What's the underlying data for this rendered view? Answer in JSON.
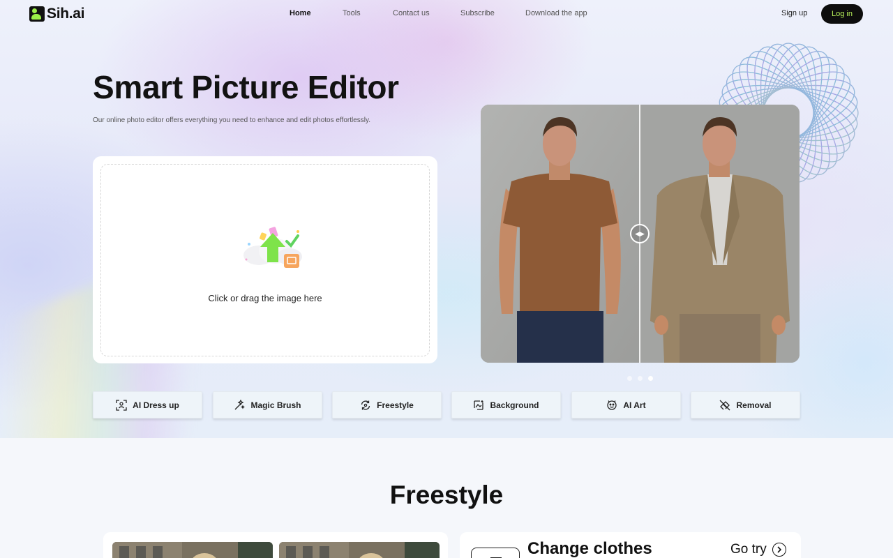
{
  "brand": {
    "name": "Sih.ai",
    "accent": "#9bf048"
  },
  "nav": {
    "items": [
      {
        "label": "Home",
        "active": true
      },
      {
        "label": "Tools",
        "active": false
      },
      {
        "label": "Contact us",
        "active": false
      },
      {
        "label": "Subscribe",
        "active": false
      },
      {
        "label": "Download the app",
        "active": false
      }
    ]
  },
  "auth": {
    "signup": "Sign up",
    "login": "Log in"
  },
  "hero": {
    "title": "Smart Picture Editor",
    "subtitle": "Our online photo editor offers everything you need to enhance and edit photos effortlessly."
  },
  "upload": {
    "prompt": "Click or drag the image here",
    "icon": "upload-cloud-icon"
  },
  "compare": {
    "slides": 3,
    "active_slide": 3,
    "handle_icon": "drag-arrows-icon"
  },
  "tools": [
    {
      "label": "AI Dress up",
      "icon": "dress-up-icon"
    },
    {
      "label": "Magic Brush",
      "icon": "magic-brush-icon"
    },
    {
      "label": "Freestyle",
      "icon": "freestyle-icon"
    },
    {
      "label": "Background",
      "icon": "background-icon"
    },
    {
      "label": "AI Art",
      "icon": "ai-art-icon"
    },
    {
      "label": "Removal",
      "icon": "removal-icon"
    }
  ],
  "section": {
    "title": "Freestyle",
    "feature": {
      "title": "Change clothes",
      "cta": "Go try"
    }
  }
}
